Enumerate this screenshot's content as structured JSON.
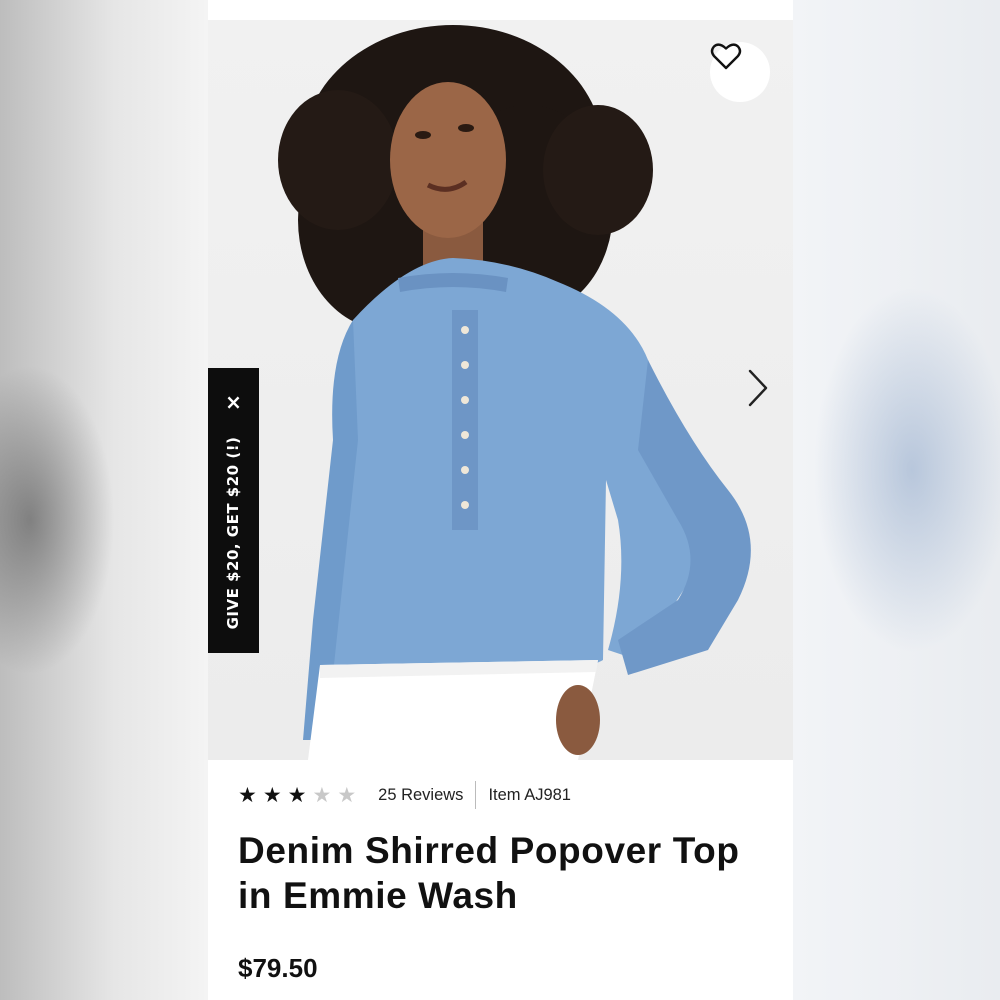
{
  "product": {
    "rating": 3,
    "rating_max": 5,
    "reviews_label": "25 Reviews",
    "item_label": "Item AJ981",
    "title": "Denim Shirred Popover Top in Emmie Wash",
    "price": "$79.50"
  },
  "promo": {
    "label": "GIVE $20, GET $20 (!)",
    "close_glyph": "×"
  },
  "icons": {
    "favorite": "heart-icon",
    "next": "chevron-right-icon",
    "star_full": "★",
    "star_empty": "★"
  },
  "colors": {
    "promo_bg": "#0d0d0d",
    "denim": "#7da7d4",
    "text": "#111111"
  }
}
